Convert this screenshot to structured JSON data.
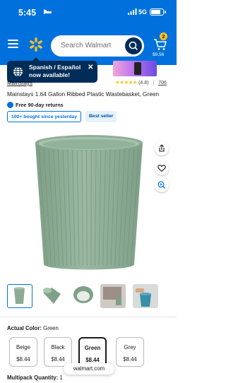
{
  "status_bar": {
    "time": "5:45",
    "network": "5G",
    "battery_level": 0.85
  },
  "header": {
    "search_placeholder": "Search Walmart",
    "cart_count": "2",
    "cart_total": "$9.56",
    "brand_color": "#0071dc",
    "accent_color": "#ffc220",
    "dark_blue": "#002d58"
  },
  "language_tooltip": {
    "text": "Spanish / Español now available!"
  },
  "product": {
    "brand": "Mainstays",
    "title": "Mainstays 1.64 Gallon Ribbed Plastic Wastebasket, Green",
    "rating_value": 4.8,
    "rating_text": "(4.8)",
    "rating_sep": "|",
    "review_count": "706",
    "returns": "Free 90-day returns",
    "bought_badge": "100+ bought since yesterday",
    "best_seller": "Best seller",
    "main_color": "#8cab94"
  },
  "thumbnails": [
    "thumb-front",
    "thumb-side",
    "thumb-top",
    "thumb-room",
    "thumb-in-use"
  ],
  "variant": {
    "label": "Actual Color:",
    "selected": "Green",
    "options": [
      {
        "name": "Beige",
        "price": "$8.44"
      },
      {
        "name": "Black",
        "price": "$8.44"
      },
      {
        "name": "Green",
        "price": "$8.44"
      },
      {
        "name": "Grey",
        "price": "$8.44"
      }
    ]
  },
  "browser": {
    "url": "walmart.com"
  },
  "multipack": {
    "label": "Multipack Quantity:",
    "value": "1"
  }
}
